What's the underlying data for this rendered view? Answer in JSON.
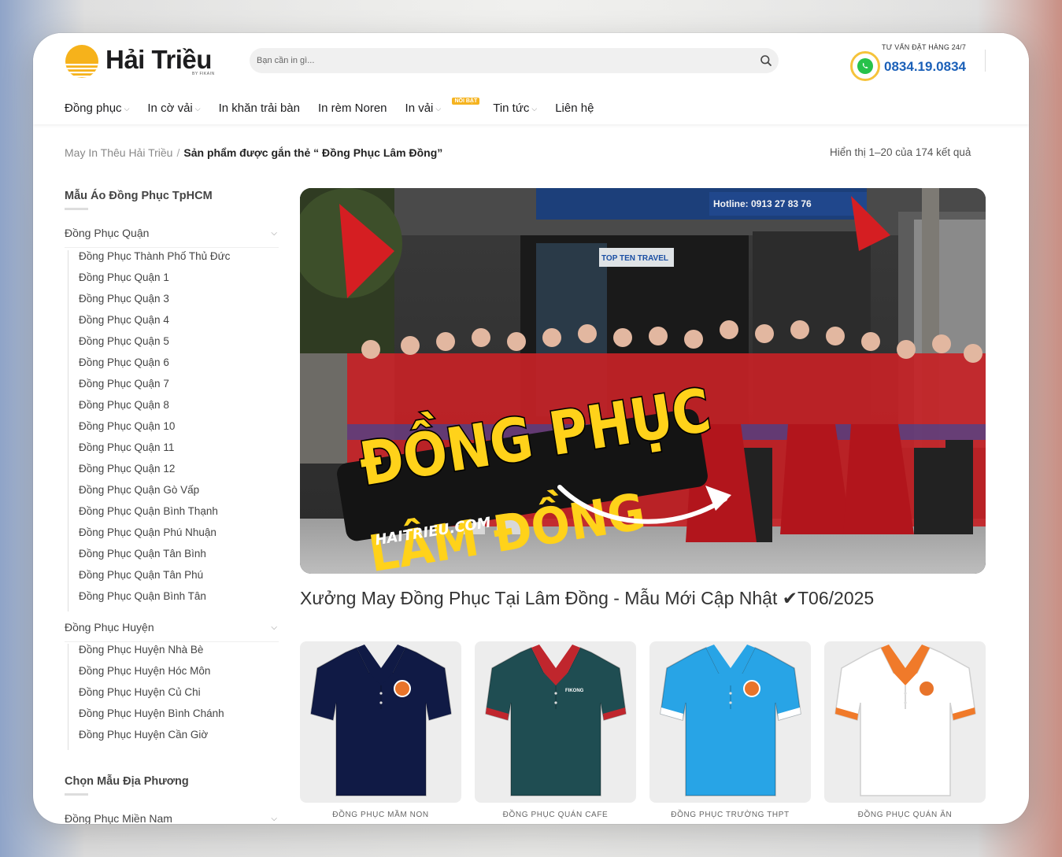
{
  "header": {
    "logo_text": "Hải Triều",
    "logo_sub": "BY FIKAIN",
    "search_placeholder": "Bạn cần in gì...",
    "hotline_label": "TƯ VẤN ĐẶT HÀNG 24/7",
    "hotline_number": "0834.19.0834"
  },
  "nav": {
    "items": [
      {
        "label": "Đồng phục",
        "dropdown": true
      },
      {
        "label": "In cờ vải",
        "dropdown": true
      },
      {
        "label": "In khăn trải bàn",
        "dropdown": false
      },
      {
        "label": "In rèm Noren",
        "dropdown": false
      },
      {
        "label": "In vải",
        "dropdown": true,
        "badge": "NỔI BẬT"
      },
      {
        "label": "Tin tức",
        "dropdown": true
      },
      {
        "label": "Liên hệ",
        "dropdown": false
      }
    ]
  },
  "breadcrumb": {
    "home": "May In Thêu Hải Triều",
    "separator": "/",
    "current": "Sản phẩm được gắn thẻ “ Đồng Phục Lâm Đồng”"
  },
  "result_count": "Hiển thị 1–20 của 174 kết quả",
  "sidebar": {
    "title1": "Mẫu Áo Đồng Phục TpHCM",
    "group_quan": {
      "label": "Đồng Phục Quận",
      "items": [
        "Đồng Phục Thành Phố Thủ Đức",
        "Đồng Phục Quận 1",
        "Đồng Phục Quận 3",
        "Đồng Phục Quận 4",
        "Đồng Phục Quận 5",
        "Đồng Phục Quận 6",
        "Đồng Phục Quận 7",
        "Đồng Phục Quận 8",
        "Đồng Phục Quận 10",
        "Đồng Phục Quận 11",
        "Đồng Phục Quận 12",
        "Đồng Phục Quận Gò Vấp",
        "Đồng Phục Quận Bình Thạnh",
        "Đồng Phục Quận Phú Nhuận",
        "Đồng Phục Quận Tân Bình",
        "Đồng Phục Quận Tân Phú",
        "Đồng Phục Quận Bình Tân"
      ]
    },
    "group_huyen": {
      "label": "Đồng Phục Huyện",
      "items": [
        "Đồng Phục Huyện Nhà Bè",
        "Đồng Phục Huyện Hóc Môn",
        "Đồng Phục Huyện Củ Chi",
        "Đồng Phục Huyện Bình Chánh",
        "Đồng Phục Huyện Cần Giờ"
      ]
    },
    "title2": "Chọn Mẫu Địa Phương",
    "group_mien_nam": {
      "label": "Đồng Phục Miền Nam"
    }
  },
  "hero": {
    "headline1": "ĐỒNG PHỤC",
    "headline2": "LÂM ĐỒNG",
    "site": "HAITRIEU.COM",
    "shop_sign": "TOP TEN TRAVEL",
    "hotline_sign": "Hotline: 0913 27 83 76"
  },
  "page_heading": "Xưởng May Đồng Phục Tại Lâm Đồng - Mẫu Mới Cập Nhật ✔T06/2025",
  "products": [
    {
      "category": "ĐỒNG PHỤC MẦM NON",
      "color": "#101a45",
      "collar": "#101a45",
      "trim": "#101a45",
      "logo_text": ""
    },
    {
      "category": "ĐỒNG PHỤC QUÁN CAFE",
      "color": "#1f4d52",
      "collar": "#c0262d",
      "trim": "#c0262d",
      "logo_text": "FIKONG"
    },
    {
      "category": "ĐỒNG PHỤC TRƯỜNG THPT",
      "color": "#28a4e6",
      "collar": "#28a4e6",
      "trim": "#ffffff",
      "logo_text": ""
    },
    {
      "category": "ĐỒNG PHỤC QUÁN ĂN",
      "color": "#ffffff",
      "collar": "#f07a2a",
      "trim": "#f07a2a",
      "logo_text": ""
    }
  ],
  "colors": {
    "accent_blue": "#1b60b8",
    "hero_yellow": "#ffd21a",
    "badge": "#f5b31f"
  }
}
